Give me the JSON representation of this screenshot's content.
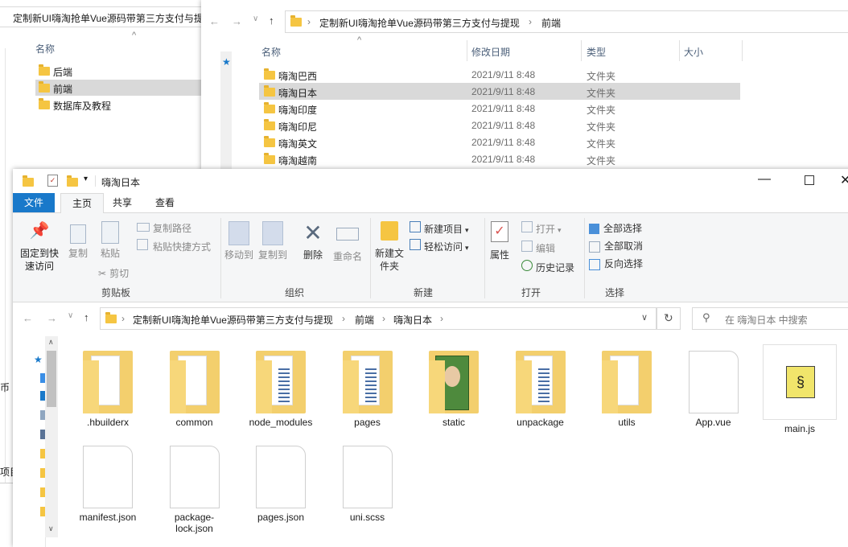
{
  "back1": {
    "breadcrumb": "定制新UI嗨淘抢单Vue源码带第三方支付与提",
    "col_name": "名称",
    "items": [
      "后端",
      "前端",
      "数据库及教程"
    ],
    "edge_labels": [
      "币",
      "项目"
    ]
  },
  "back2": {
    "breadcrumb": [
      "定制新UI嗨淘抢单Vue源码带第三方支付与提现",
      "前端"
    ],
    "columns": {
      "name": "名称",
      "date": "修改日期",
      "type": "类型",
      "size": "大小"
    },
    "rows": [
      {
        "name": "嗨淘巴西",
        "date": "2021/9/11 8:48",
        "type": "文件夹"
      },
      {
        "name": "嗨淘日本",
        "date": "2021/9/11 8:48",
        "type": "文件夹"
      },
      {
        "name": "嗨淘印度",
        "date": "2021/9/11 8:48",
        "type": "文件夹"
      },
      {
        "name": "嗨淘印尼",
        "date": "2021/9/11 8:48",
        "type": "文件夹"
      },
      {
        "name": "嗨淘英文",
        "date": "2021/9/11 8:48",
        "type": "文件夹"
      },
      {
        "name": "嗨淘越南",
        "date": "2021/9/11 8:48",
        "type": "文件夹"
      }
    ],
    "selected_index": 1
  },
  "main": {
    "title": "嗨淘日本",
    "tabs": {
      "file": "文件",
      "home": "主页",
      "share": "共享",
      "view": "查看"
    },
    "clipboard": {
      "pin": "固定到快速访问",
      "copy": "复制",
      "paste": "粘贴",
      "copy_path": "复制路径",
      "paste_shortcut": "粘贴快捷方式",
      "cut": "剪切",
      "label": "剪贴板"
    },
    "organize": {
      "move_to": "移动到",
      "copy_to": "复制到",
      "delete": "删除",
      "rename": "重命名",
      "label": "组织"
    },
    "new": {
      "new_folder": "新建文件夹",
      "new_item": "新建项目",
      "easy_access": "轻松访问",
      "label": "新建"
    },
    "open": {
      "properties": "属性",
      "open": "打开",
      "edit": "编辑",
      "history": "历史记录",
      "label": "打开"
    },
    "select": {
      "select_all": "全部选择",
      "select_none": "全部取消",
      "invert": "反向选择",
      "label": "选择"
    },
    "address": [
      "定制新UI嗨淘抢单Vue源码带第三方支付与提现",
      "前端",
      "嗨淘日本"
    ],
    "search_placeholder": "在 嗨淘日本 中搜索",
    "files_row1": [
      ".hbuilderx",
      "common",
      "node_modules",
      "pages",
      "static",
      "unpackage",
      "utils",
      "App.vue",
      "main.js"
    ],
    "files_row2": [
      "manifest.json",
      "package-lock.json",
      "pages.json",
      "uni.scss"
    ]
  },
  "colors": {
    "accent": "#1979ca",
    "folder": "#f5c542",
    "selected": "#d9d9d9"
  },
  "icons": [
    "folder-icon",
    "back-arrow-icon",
    "forward-arrow-icon",
    "up-arrow-icon",
    "refresh-icon",
    "search-icon",
    "minimize-icon",
    "maximize-icon",
    "close-icon"
  ]
}
